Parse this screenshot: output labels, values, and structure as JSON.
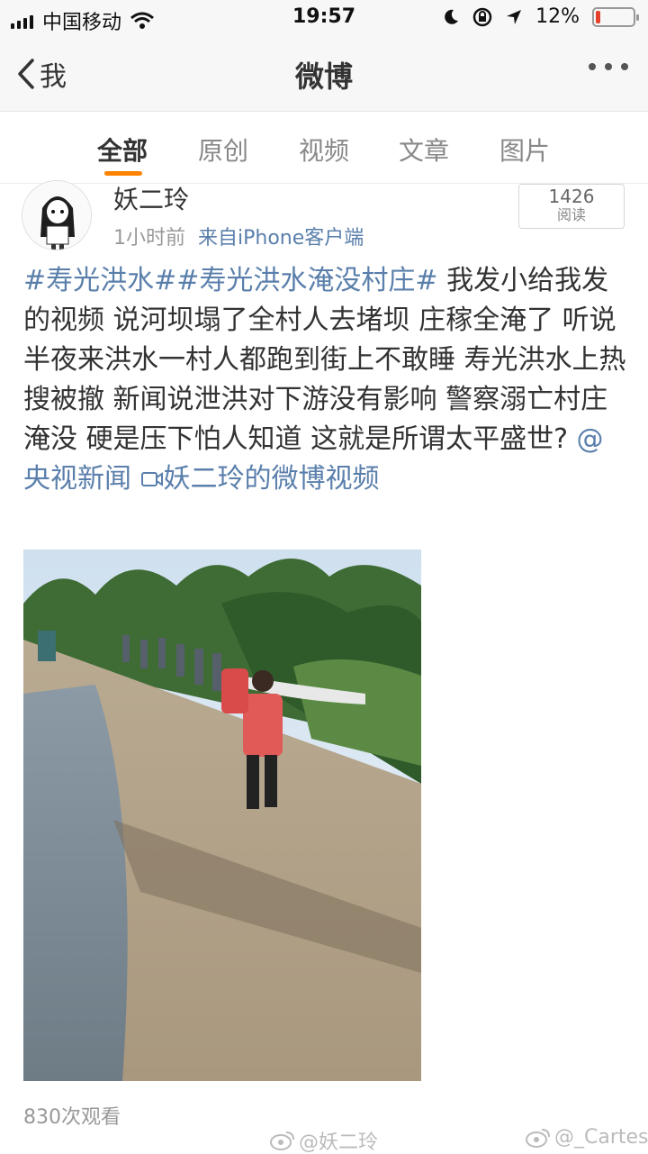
{
  "status_bar": {
    "carrier": "中国移动",
    "time": "19:57",
    "battery_percent": "12%",
    "battery_level": 0.12,
    "battery_color": "#e5402b"
  },
  "nav": {
    "back_label": "我",
    "title": "微博"
  },
  "tabs": [
    {
      "label": "全部",
      "active": true
    },
    {
      "label": "原创",
      "active": false
    },
    {
      "label": "视频",
      "active": false
    },
    {
      "label": "文章",
      "active": false
    },
    {
      "label": "图片",
      "active": false
    }
  ],
  "post": {
    "author": "妖二玲",
    "time": "1小时前",
    "source": "来自iPhone客户端",
    "views": "1426",
    "views_label": "阅读",
    "hashtag1": "#寿光洪水#",
    "hashtag2": "#寿光洪水淹没村庄#",
    "text": " 我发小给我发的视频  说河坝塌了全村人去堵坝  庄稼全淹了 听说半夜来洪水一村人都跑到街上不敢睡  寿光洪水上热搜被撤  新闻说泄洪对下游没有影响  警察溺亡村庄淹没 硬是压下怕人知道  这就是所谓太平盛世? ",
    "mention": "@央视新闻",
    "video_link": "妖二玲的微博视频",
    "video_views": "830次观看"
  },
  "watermarks": {
    "left": "@妖二玲",
    "right": "@_Cartes"
  },
  "colors": {
    "link": "#5a7fab",
    "accent": "#ff8200"
  }
}
